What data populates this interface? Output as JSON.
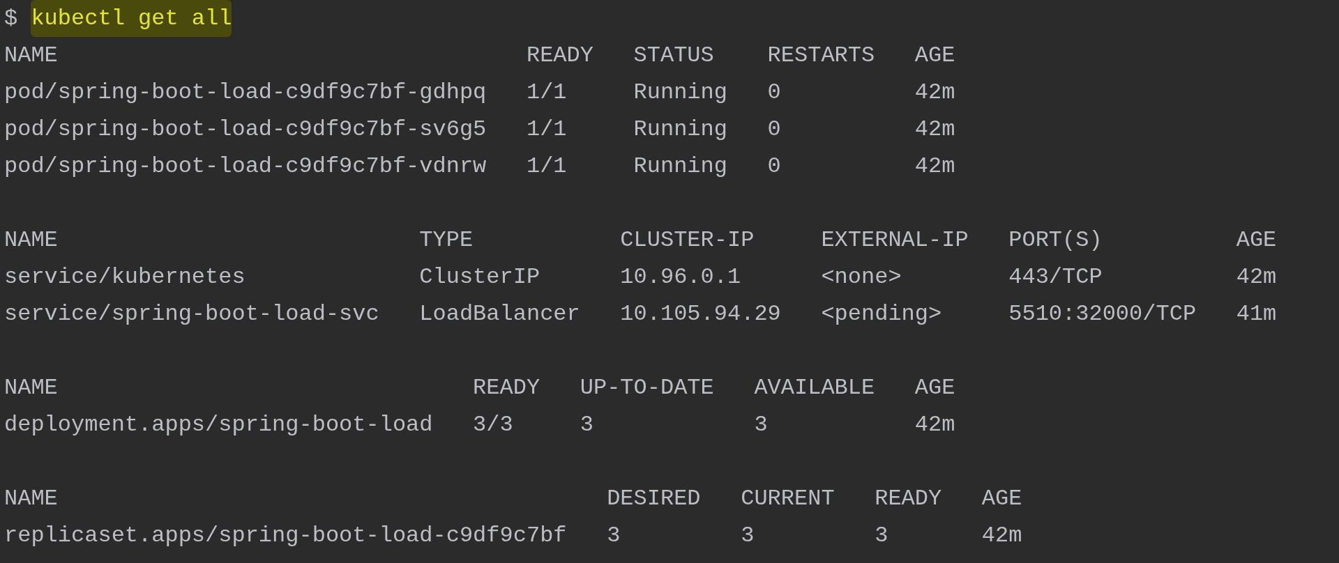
{
  "command_line": {
    "prompt": "$",
    "command": "kubectl get all",
    "highlighted": true
  },
  "tables": [
    {
      "columns": [
        "NAME",
        "READY",
        "STATUS",
        "RESTARTS",
        "AGE"
      ],
      "rows": [
        [
          "pod/spring-boot-load-c9df9c7bf-gdhpq",
          "1/1",
          "Running",
          "0",
          "42m"
        ],
        [
          "pod/spring-boot-load-c9df9c7bf-sv6g5",
          "1/1",
          "Running",
          "0",
          "42m"
        ],
        [
          "pod/spring-boot-load-c9df9c7bf-vdnrw",
          "1/1",
          "Running",
          "0",
          "42m"
        ]
      ]
    },
    {
      "columns": [
        "NAME",
        "TYPE",
        "CLUSTER-IP",
        "EXTERNAL-IP",
        "PORT(S)",
        "AGE"
      ],
      "rows": [
        [
          "service/kubernetes",
          "ClusterIP",
          "10.96.0.1",
          "<none>",
          "443/TCP",
          "42m"
        ],
        [
          "service/spring-boot-load-svc",
          "LoadBalancer",
          "10.105.94.29",
          "<pending>",
          "5510:32000/TCP",
          "41m"
        ]
      ]
    },
    {
      "columns": [
        "NAME",
        "READY",
        "UP-TO-DATE",
        "AVAILABLE",
        "AGE"
      ],
      "rows": [
        [
          "deployment.apps/spring-boot-load",
          "3/3",
          "3",
          "3",
          "42m"
        ]
      ]
    },
    {
      "columns": [
        "NAME",
        "DESIRED",
        "CURRENT",
        "READY",
        "AGE"
      ],
      "rows": [
        [
          "replicaset.apps/spring-boot-load-c9df9c7bf",
          "3",
          "3",
          "3",
          "42m"
        ]
      ]
    }
  ]
}
